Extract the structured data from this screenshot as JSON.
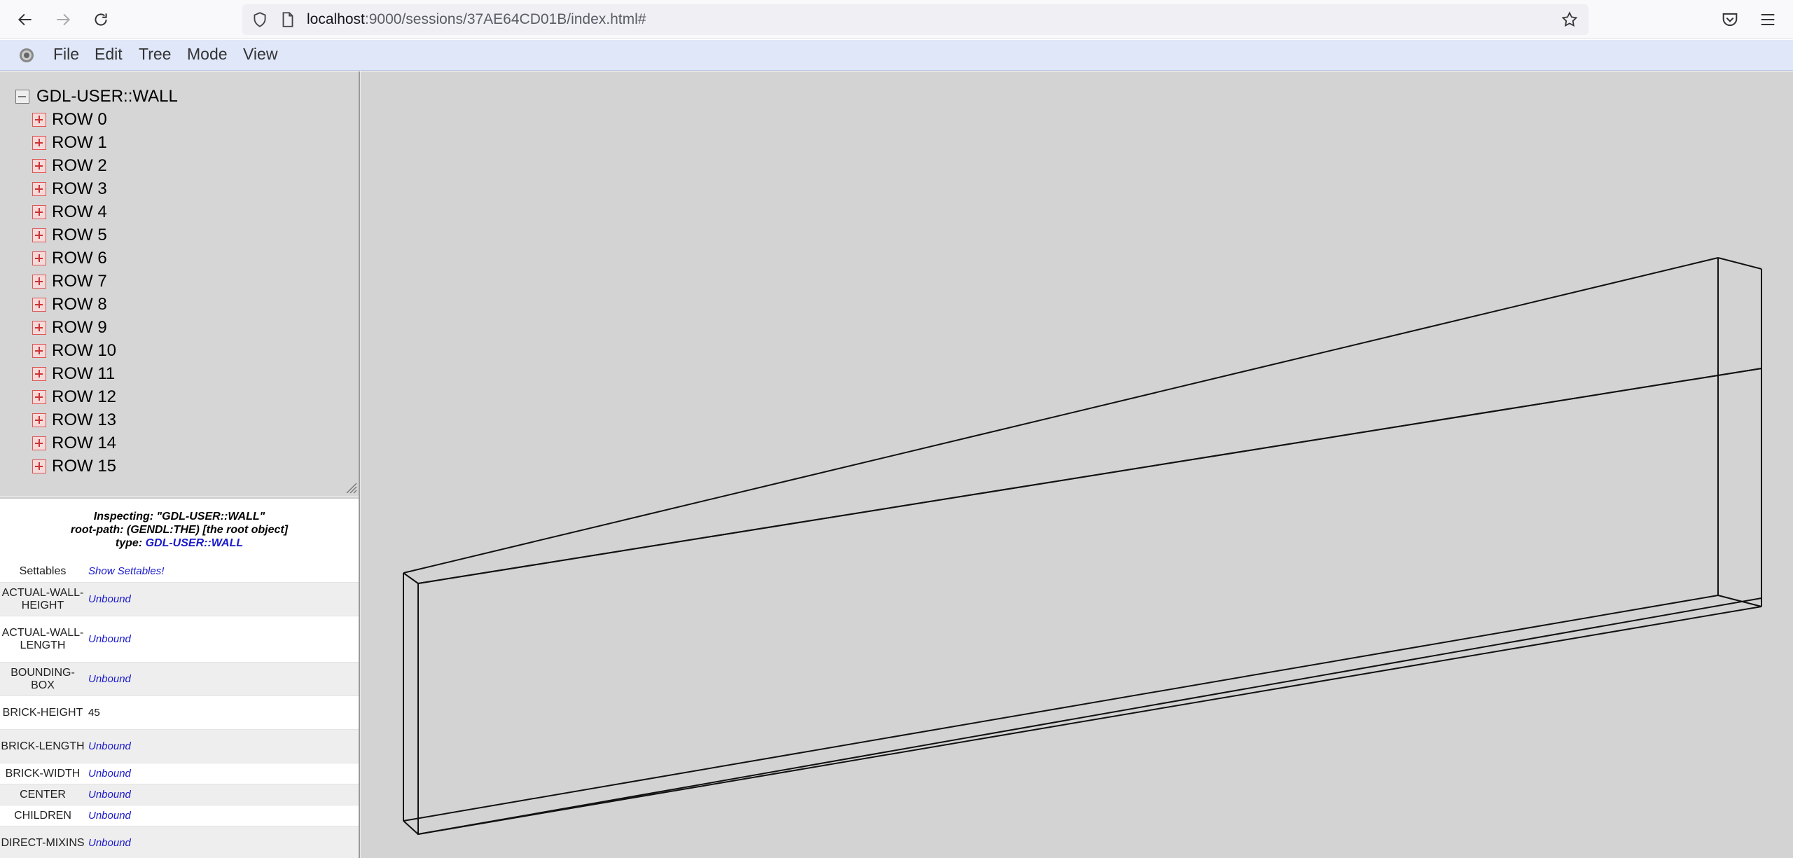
{
  "browser": {
    "url_host": "localhost",
    "url_rest": ":9000/sessions/37AE64CD01B/index.html#"
  },
  "menu": {
    "items": [
      {
        "label": "File"
      },
      {
        "label": "Edit"
      },
      {
        "label": "Tree"
      },
      {
        "label": "Mode"
      },
      {
        "label": "View"
      }
    ]
  },
  "tree": {
    "root_label": "GDL-USER::WALL",
    "rows": [
      {
        "label": "ROW 0"
      },
      {
        "label": "ROW 1"
      },
      {
        "label": "ROW 2"
      },
      {
        "label": "ROW 3"
      },
      {
        "label": "ROW 4"
      },
      {
        "label": "ROW 5"
      },
      {
        "label": "ROW 6"
      },
      {
        "label": "ROW 7"
      },
      {
        "label": "ROW 8"
      },
      {
        "label": "ROW 9"
      },
      {
        "label": "ROW 10"
      },
      {
        "label": "ROW 11"
      },
      {
        "label": "ROW 12"
      },
      {
        "label": "ROW 13"
      },
      {
        "label": "ROW 14"
      },
      {
        "label": "ROW 15"
      }
    ]
  },
  "inspector": {
    "inspecting": "Inspecting: \"GDL-USER::WALL\"",
    "root_path": "root-path: (GENDL:THE) [the root object]",
    "type_prefix": "type:",
    "type_value": "GDL-USER::WALL",
    "slots": [
      {
        "name": "Settables",
        "value": "Show Settables!",
        "kind": "link"
      },
      {
        "name": "ACTUAL-WALL-HEIGHT",
        "value": "Unbound",
        "kind": "link"
      },
      {
        "name": "ACTUAL-WALL-LENGTH",
        "value": "Unbound",
        "kind": "link"
      },
      {
        "name": "BOUNDING-BOX",
        "value": "Unbound",
        "kind": "link"
      },
      {
        "name": "BRICK-HEIGHT",
        "value": "45",
        "kind": "plain"
      },
      {
        "name": "BRICK-LENGTH",
        "value": "Unbound",
        "kind": "link"
      },
      {
        "name": "BRICK-WIDTH",
        "value": "Unbound",
        "kind": "link"
      },
      {
        "name": "CENTER",
        "value": "Unbound",
        "kind": "link"
      },
      {
        "name": "CHILDREN",
        "value": "Unbound",
        "kind": "link"
      },
      {
        "name": "DIRECT-MIXINS",
        "value": "Unbound",
        "kind": "link"
      }
    ]
  }
}
